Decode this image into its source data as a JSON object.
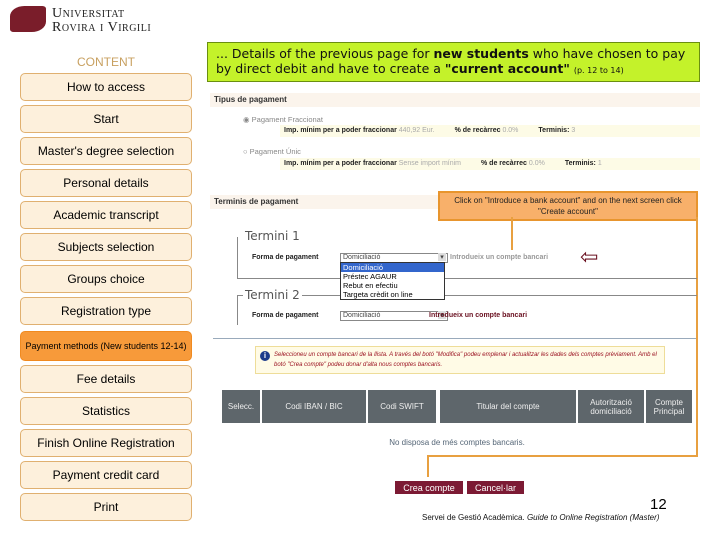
{
  "header": {
    "logo_line1": "Universitat",
    "logo_line2": "Rovira i Virgili"
  },
  "sidebar": {
    "title": "CONTENT",
    "items": [
      "How to access",
      "Start",
      "Master's degree selection",
      "Personal details",
      "Academic transcript",
      "Subjects selection",
      "Groups choice",
      "Registration type",
      "Payment methods (New students 12-14)",
      "Fee details",
      "Statistics",
      "Finish Online Registration",
      "Payment credit card",
      "Print"
    ],
    "active_index": 8
  },
  "callout": {
    "pre": "... Details of the previous page for ",
    "b1": "new students",
    "mid": " who have chosen to pay by direct debit and have to create a ",
    "b2": "\"current account\"",
    "pages": "(p. 12 to 14)"
  },
  "tipus": {
    "title": "Tipus de pagament",
    "options": [
      {
        "label": "Pagament Fraccionat",
        "selected": true,
        "min_label": "Imp. mínim per a poder fraccionar",
        "min_value": "440,92 Eur.",
        "rec_label": "% de recàrrec",
        "rec_value": "0.0%",
        "term_label": "Terminis:",
        "term_value": "3"
      },
      {
        "label": "Pagament Únic",
        "selected": false,
        "min_label": "Imp. mínim per a poder fraccionar",
        "min_value": "Sense import mínim",
        "rec_label": "% de recàrrec",
        "rec_value": "0.0%",
        "term_label": "Terminis:",
        "term_value": "1"
      }
    ]
  },
  "terminis": {
    "title": "Terminis de pagament",
    "t1": "Termini 1",
    "t2": "Termini 2",
    "forma_label": "Forma de pagament",
    "selected": "Domiciliació",
    "options": [
      "Domiciliació",
      "Préstec AGAUR",
      "Rebut en efectiu",
      "Targeta crèdit on line"
    ],
    "link": "Introdueix un compte bancari"
  },
  "note": "Click on \"Introduce a bank account\" and on the next screen click \"Create account\"",
  "info": "Seleccioneu un compte bancari de la llista. A través del botó \"Modifica\" podeu emplenar i actualitzar les dades dels comptes prèviament. Amb el botó \"Crea compte\" podeu donar d'alta nous comptes bancaris.",
  "table": {
    "headers": [
      "Selecc.",
      "Codi IBAN / BIC",
      "Codi SWIFT",
      "Titular del compte",
      "Autorització domiciliació",
      "Compte Principal"
    ],
    "empty": "No disposa de més comptes bancaris."
  },
  "buttons": {
    "create": "Crea compte",
    "cancel": "Cancel·lar"
  },
  "footer": {
    "page": "12",
    "text_pre": "Servei de Gestió Acadèmica. ",
    "text_it": "Guide to Online Registration (Master)"
  },
  "colors": {
    "accent_green": "#c4f22a",
    "nav_active": "#f79a3a",
    "button": "#7c1a34"
  }
}
